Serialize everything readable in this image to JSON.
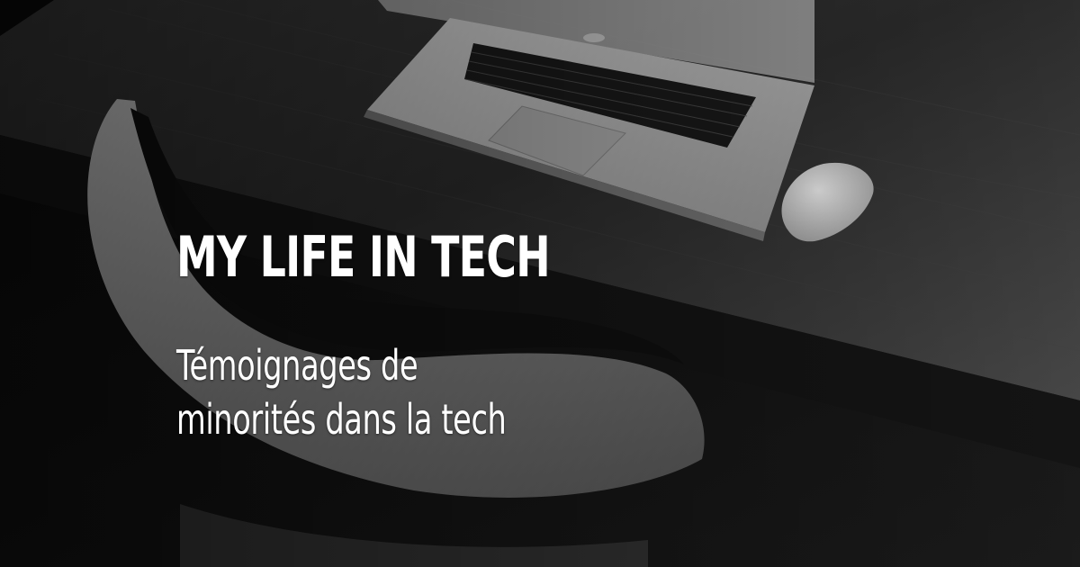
{
  "banner": {
    "title": "MY LIFE IN TECH",
    "subtitle_line1": "Témoignages de",
    "subtitle_line2": "minorités dans la tech"
  },
  "photo": {
    "objects": [
      "desk-icon",
      "laptop-icon",
      "mouse-icon",
      "chair-icon"
    ],
    "tone": "grayscale"
  }
}
